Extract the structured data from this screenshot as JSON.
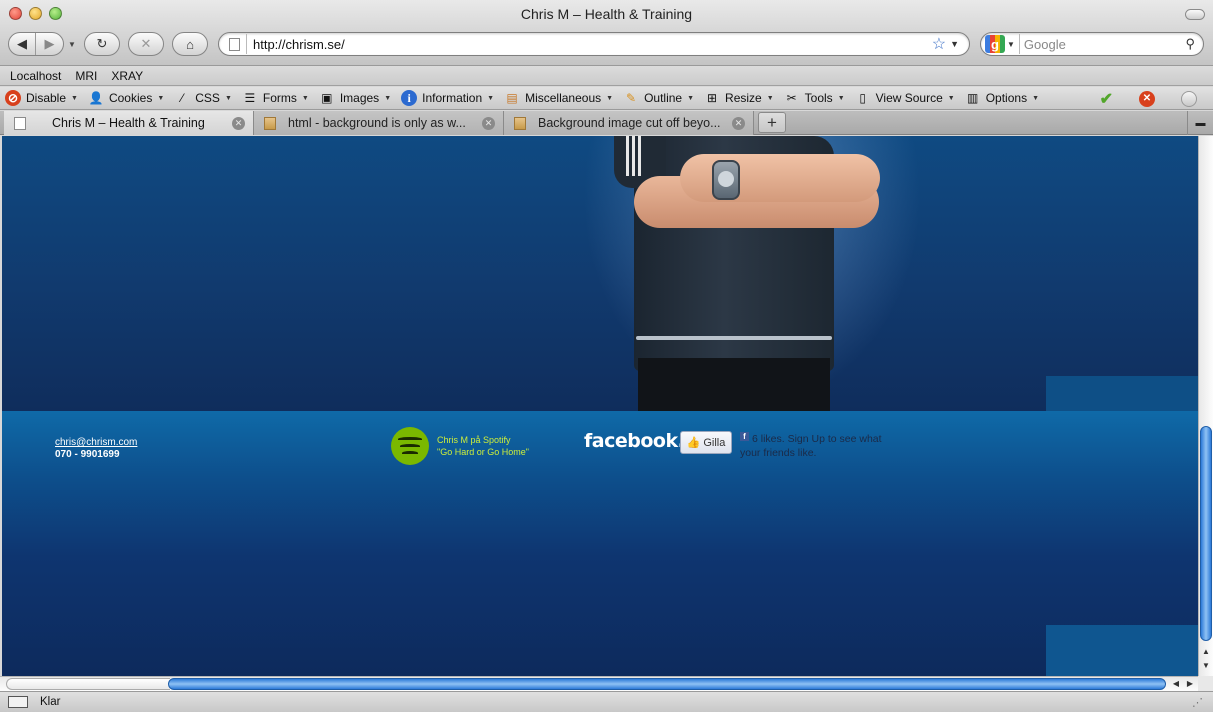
{
  "window": {
    "title": "Chris M – Health & Training"
  },
  "nav": {
    "url": "http://chrism.se/",
    "search_placeholder": "Google"
  },
  "bookmarks": [
    "Localhost",
    "MRI",
    "XRAY"
  ],
  "devtoolbar": [
    {
      "label": "Disable",
      "icon": "disable-icon"
    },
    {
      "label": "Cookies",
      "icon": "user-icon"
    },
    {
      "label": "CSS",
      "icon": "wand-icon"
    },
    {
      "label": "Forms",
      "icon": "forms-icon"
    },
    {
      "label": "Images",
      "icon": "image-icon"
    },
    {
      "label": "Information",
      "icon": "info-icon"
    },
    {
      "label": "Miscellaneous",
      "icon": "misc-icon"
    },
    {
      "label": "Outline",
      "icon": "pencil-icon"
    },
    {
      "label": "Resize",
      "icon": "resize-icon"
    },
    {
      "label": "Tools",
      "icon": "tools-icon"
    },
    {
      "label": "View Source",
      "icon": "page-icon"
    },
    {
      "label": "Options",
      "icon": "options-icon"
    }
  ],
  "tabs": [
    {
      "label": "Chris M – Health & Training",
      "active": true
    },
    {
      "label": "html - background is only as w...",
      "active": false
    },
    {
      "label": "Background image cut off beyo...",
      "active": false
    }
  ],
  "page": {
    "contact_email": "chris@chrism.com",
    "contact_phone": "070 - 9901699",
    "spotify_line1": "Chris M på Spotify",
    "spotify_line2": "\"Go Hard or Go Home\"",
    "facebook_word": "facebook.",
    "like_button": "Gilla",
    "fb_text": "6 likes. Sign Up to see what your friends like."
  },
  "status": {
    "text": "Klar"
  },
  "colors": {
    "hero_top": "#0f4a82",
    "footer_band": "#0f6aa8",
    "page_bottom": "#0d2a5c",
    "spotify_green": "#7ab800",
    "spotify_text": "#cdee3a",
    "scroll_thumb": "#2d7ad8"
  }
}
